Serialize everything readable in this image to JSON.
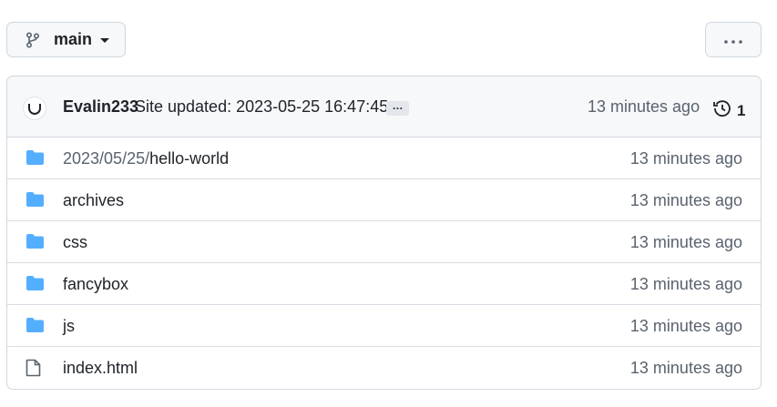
{
  "branch": {
    "name": "main",
    "icon": "git-branch-icon"
  },
  "more_button": {
    "icon": "kebab-horizontal-icon"
  },
  "commit": {
    "author": "Evalin233",
    "message": "Site updated: 2023-05-25 16:47:45",
    "ellipsis": "…",
    "time": "13 minutes ago",
    "history_count": "1",
    "history_icon": "history-icon"
  },
  "files": [
    {
      "prefix": "2023/05/25/",
      "name": "hello-world",
      "type": "directory",
      "time": "13 minutes ago"
    },
    {
      "prefix": "",
      "name": "archives",
      "type": "directory",
      "time": "13 minutes ago"
    },
    {
      "prefix": "",
      "name": "css",
      "type": "directory",
      "time": "13 minutes ago"
    },
    {
      "prefix": "",
      "name": "fancybox",
      "type": "directory",
      "time": "13 minutes ago"
    },
    {
      "prefix": "",
      "name": "js",
      "type": "directory",
      "time": "13 minutes ago"
    },
    {
      "prefix": "",
      "name": "index.html",
      "type": "file",
      "time": "13 minutes ago"
    }
  ],
  "colors": {
    "folder": "#54aeff",
    "muted_text": "#59636e",
    "border": "#d0d7de",
    "header_bg": "#f6f8fa"
  }
}
